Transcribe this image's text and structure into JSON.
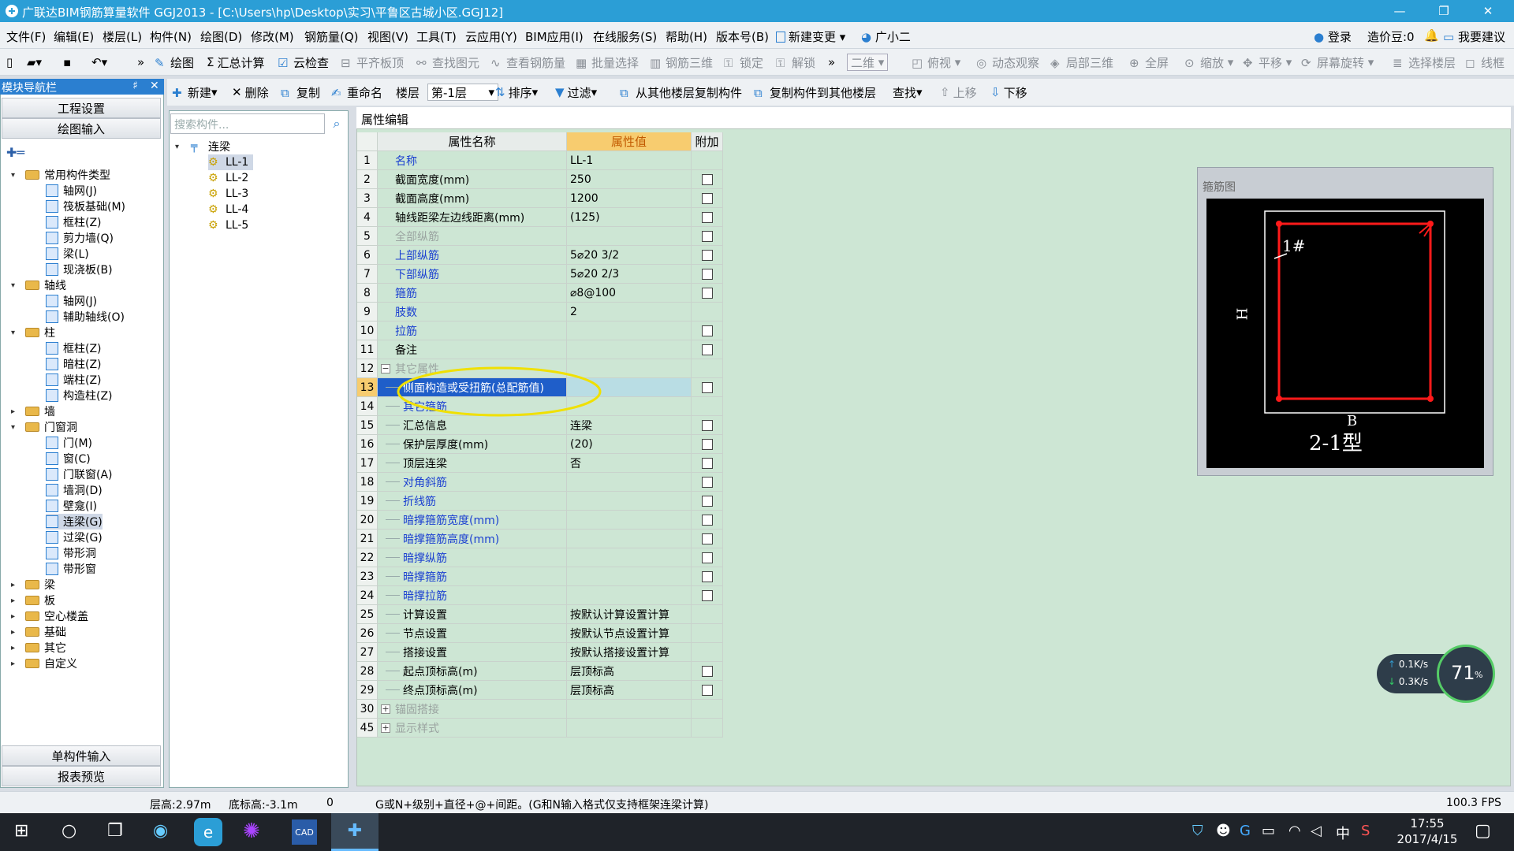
{
  "window": {
    "title": "广联达BIM钢筋算量软件 GGJ2013 - [C:\\Users\\hp\\Desktop\\实习\\平鲁区古城小区.GGJ12]",
    "minimize": "—",
    "maximize": "❐",
    "close": "✕"
  },
  "menu": {
    "items": [
      "文件(F)",
      "编辑(E)",
      "楼层(L)",
      "构件(N)",
      "绘图(D)",
      "修改(M)",
      "钢筋量(Q)",
      "视图(V)",
      "工具(T)",
      "云应用(Y)",
      "BIM应用(I)",
      "在线服务(S)",
      "帮助(H)",
      "版本号(B)"
    ],
    "new_change": "新建变更",
    "assistant": "广小二",
    "login": "登录",
    "price_bean": "造价豆:0",
    "suggest": "我要建议"
  },
  "toolbar1": {
    "items": [
      "绘图",
      "汇总计算",
      "云检查",
      "平齐板顶",
      "查找图元",
      "查看钢筋量",
      "批量选择",
      "钢筋三维",
      "锁定",
      "解锁",
      "二维",
      "俯视",
      "动态观察",
      "局部三维",
      "全屏",
      "缩放",
      "平移",
      "屏幕旋转",
      "选择楼层",
      "线框"
    ]
  },
  "toolbar2": {
    "new": "新建",
    "delete": "删除",
    "copy": "复制",
    "rename": "重命名",
    "floor_label": "楼层",
    "floor_value": "第-1层",
    "sort": "排序",
    "filter": "过滤",
    "copy_from": "从其他楼层复制构件",
    "copy_to": "复制构件到其他楼层",
    "find": "查找",
    "move_up": "上移",
    "move_down": "下移"
  },
  "leftpanel": {
    "title": "模块导航栏",
    "pin": "♯",
    "close": "✕",
    "btn_project": "工程设置",
    "btn_draw": "绘图输入",
    "btn_single": "单构件输入",
    "btn_report": "报表预览",
    "tree": [
      {
        "label": "常用构件类型",
        "level": 0,
        "folder": true,
        "exp": "▾"
      },
      {
        "label": "轴网(J)",
        "level": 1
      },
      {
        "label": "筏板基础(M)",
        "level": 1
      },
      {
        "label": "框柱(Z)",
        "level": 1
      },
      {
        "label": "剪力墙(Q)",
        "level": 1
      },
      {
        "label": "梁(L)",
        "level": 1
      },
      {
        "label": "现浇板(B)",
        "level": 1
      },
      {
        "label": "轴线",
        "level": 0,
        "folder": true,
        "exp": "▾"
      },
      {
        "label": "轴网(J)",
        "level": 1
      },
      {
        "label": "辅助轴线(O)",
        "level": 1
      },
      {
        "label": "柱",
        "level": 0,
        "folder": true,
        "exp": "▾"
      },
      {
        "label": "框柱(Z)",
        "level": 1
      },
      {
        "label": "暗柱(Z)",
        "level": 1
      },
      {
        "label": "端柱(Z)",
        "level": 1
      },
      {
        "label": "构造柱(Z)",
        "level": 1
      },
      {
        "label": "墙",
        "level": 0,
        "folder": true,
        "exp": "▸"
      },
      {
        "label": "门窗洞",
        "level": 0,
        "folder": true,
        "exp": "▾"
      },
      {
        "label": "门(M)",
        "level": 1
      },
      {
        "label": "窗(C)",
        "level": 1
      },
      {
        "label": "门联窗(A)",
        "level": 1
      },
      {
        "label": "墙洞(D)",
        "level": 1
      },
      {
        "label": "壁龛(I)",
        "level": 1
      },
      {
        "label": "连梁(G)",
        "level": 1,
        "selected": true
      },
      {
        "label": "过梁(G)",
        "level": 1
      },
      {
        "label": "带形洞",
        "level": 1
      },
      {
        "label": "带形窗",
        "level": 1
      },
      {
        "label": "梁",
        "level": 0,
        "folder": true,
        "exp": "▸"
      },
      {
        "label": "板",
        "level": 0,
        "folder": true,
        "exp": "▸"
      },
      {
        "label": "空心楼盖",
        "level": 0,
        "folder": true,
        "exp": "▸"
      },
      {
        "label": "基础",
        "level": 0,
        "folder": true,
        "exp": "▸"
      },
      {
        "label": "其它",
        "level": 0,
        "folder": true,
        "exp": "▸"
      },
      {
        "label": "自定义",
        "level": 0,
        "folder": true,
        "exp": "▸"
      }
    ]
  },
  "midpanel": {
    "search_placeholder": "搜索构件...",
    "root": "连梁",
    "items": [
      "LL-1",
      "LL-2",
      "LL-3",
      "LL-4",
      "LL-5"
    ]
  },
  "props": {
    "tab": "属性编辑",
    "col_name": "属性名称",
    "col_value": "属性值",
    "col_extra": "附加",
    "rows": [
      {
        "n": "1",
        "name": "名称",
        "value": "LL-1",
        "cb": false,
        "blue": true
      },
      {
        "n": "2",
        "name": "截面宽度(mm)",
        "value": "250",
        "cb": true
      },
      {
        "n": "3",
        "name": "截面高度(mm)",
        "value": "1200",
        "cb": true
      },
      {
        "n": "4",
        "name": "轴线距梁左边线距离(mm)",
        "value": "(125)",
        "cb": true
      },
      {
        "n": "5",
        "name": "全部纵筋",
        "value": "",
        "cb": true,
        "dim": true
      },
      {
        "n": "6",
        "name": "上部纵筋",
        "value": "5⌀20 3/2",
        "cb": true,
        "blue": true
      },
      {
        "n": "7",
        "name": "下部纵筋",
        "value": "5⌀20 2/3",
        "cb": true,
        "blue": true
      },
      {
        "n": "8",
        "name": "箍筋",
        "value": "⌀8@100",
        "cb": true,
        "blue": true
      },
      {
        "n": "9",
        "name": "肢数",
        "value": "2",
        "cb": false,
        "blue": true
      },
      {
        "n": "10",
        "name": "拉筋",
        "value": "",
        "cb": true,
        "blue": true
      },
      {
        "n": "11",
        "name": "备注",
        "value": "",
        "cb": true
      },
      {
        "n": "12",
        "name": "其它属性",
        "value": "",
        "cb": false,
        "dim": true,
        "group": "−"
      },
      {
        "n": "13",
        "name": "侧面构造或受扭筋(总配筋值)",
        "value": "",
        "cb": true,
        "blue": true,
        "sel": true,
        "indent": true
      },
      {
        "n": "14",
        "name": "其它箍筋",
        "value": "",
        "cb": false,
        "blue": true,
        "indent": true
      },
      {
        "n": "15",
        "name": "汇总信息",
        "value": "连梁",
        "cb": true,
        "indent": true
      },
      {
        "n": "16",
        "name": "保护层厚度(mm)",
        "value": "(20)",
        "cb": true,
        "indent": true
      },
      {
        "n": "17",
        "name": "顶层连梁",
        "value": "否",
        "cb": true,
        "indent": true
      },
      {
        "n": "18",
        "name": "对角斜筋",
        "value": "",
        "cb": true,
        "blue": true,
        "indent": true
      },
      {
        "n": "19",
        "name": "折线筋",
        "value": "",
        "cb": true,
        "blue": true,
        "indent": true
      },
      {
        "n": "20",
        "name": "暗撑箍筋宽度(mm)",
        "value": "",
        "cb": true,
        "blue": true,
        "indent": true
      },
      {
        "n": "21",
        "name": "暗撑箍筋高度(mm)",
        "value": "",
        "cb": true,
        "blue": true,
        "indent": true
      },
      {
        "n": "22",
        "name": "暗撑纵筋",
        "value": "",
        "cb": true,
        "blue": true,
        "indent": true
      },
      {
        "n": "23",
        "name": "暗撑箍筋",
        "value": "",
        "cb": true,
        "blue": true,
        "indent": true
      },
      {
        "n": "24",
        "name": "暗撑拉筋",
        "value": "",
        "cb": true,
        "blue": true,
        "indent": true
      },
      {
        "n": "25",
        "name": "计算设置",
        "value": "按默认计算设置计算",
        "cb": false,
        "indent": true
      },
      {
        "n": "26",
        "name": "节点设置",
        "value": "按默认节点设置计算",
        "cb": false,
        "indent": true
      },
      {
        "n": "27",
        "name": "搭接设置",
        "value": "按默认搭接设置计算",
        "cb": false,
        "indent": true
      },
      {
        "n": "28",
        "name": "起点顶标高(m)",
        "value": "层顶标高",
        "cb": true,
        "indent": true
      },
      {
        "n": "29",
        "name": "终点顶标高(m)",
        "value": "层顶标高",
        "cb": true,
        "indent": true
      },
      {
        "n": "30",
        "name": "锚固搭接",
        "value": "",
        "cb": false,
        "dim": true,
        "group": "+"
      },
      {
        "n": "45",
        "name": "显示样式",
        "value": "",
        "cb": false,
        "dim": true,
        "group": "+"
      }
    ]
  },
  "preview": {
    "title": "箍筋图",
    "label_1": "1#",
    "label_h": "H",
    "label_b": "B",
    "label_type": "2-1型"
  },
  "net": {
    "up": "0.1K/s",
    "down": "0.3K/s",
    "percent": "71",
    "unit": "%"
  },
  "status": {
    "floor_height": "层高:2.97m",
    "bottom_elev": "底标高:-3.1m",
    "zero": "0",
    "hint": "G或N+级别+直径+@+间距。(G和N输入格式仅支持框架连梁计算)",
    "fps": "100.3 FPS"
  },
  "taskbar": {
    "time": "17:55",
    "date": "2017/4/15",
    "ime": "中"
  },
  "colors": {
    "titlebar": "#2b9ed6",
    "grid_bg": "#cde6d4",
    "value_header": "#f7cc6f",
    "link_blue": "#1a3fd1",
    "rebar_red": "#ff1a1a"
  }
}
